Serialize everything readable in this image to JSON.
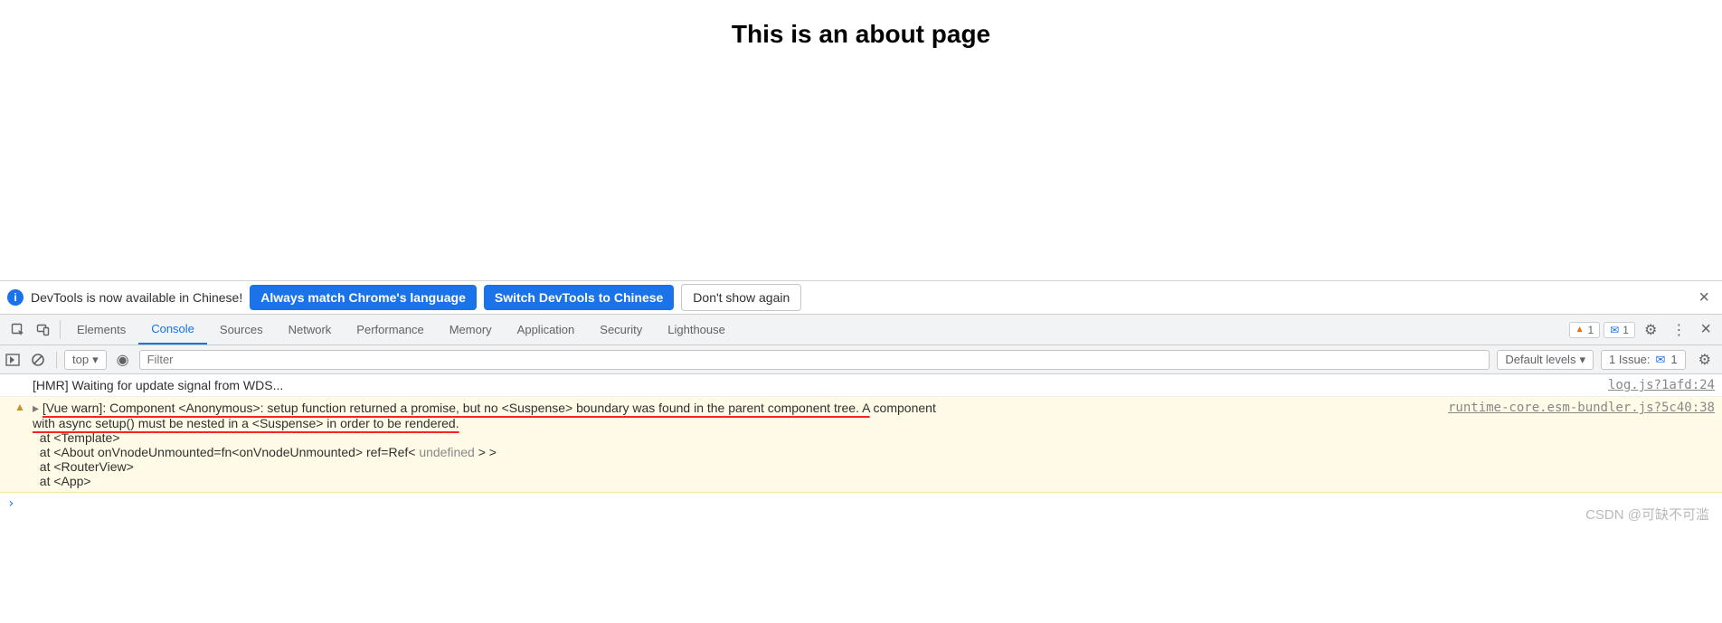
{
  "page": {
    "title": "This is an about page"
  },
  "notice": {
    "text": "DevTools is now available in Chinese!",
    "btn_match": "Always match Chrome's language",
    "btn_switch": "Switch DevTools to Chinese",
    "btn_dont": "Don't show again"
  },
  "tabs": {
    "items": [
      "Elements",
      "Console",
      "Sources",
      "Network",
      "Performance",
      "Memory",
      "Application",
      "Security",
      "Lighthouse"
    ],
    "active_index": 1,
    "warn_count": "1",
    "msg_count": "1"
  },
  "console_tb": {
    "context": "top",
    "filter_placeholder": "Filter",
    "levels": "Default levels",
    "issue_label": "1 Issue:",
    "issue_count": "1"
  },
  "log": {
    "hmr": "[HMR] Waiting for update signal from WDS...",
    "hmr_src": "log.js?1afd:24",
    "warn_red_a": "[Vue warn]: Component <Anonymous>: setup function returned a promise, but no <Suspense> boundary was found in the parent component tree. A",
    "warn_tail_a": " component ",
    "warn_src": "runtime-core.esm-bundler.js?5c40:38",
    "warn_line2": "with async setup() must be nested in a <Suspense> in order to be rendered.",
    "at1": "  at <Template>",
    "at2_a": "  at <About onVnodeUnmounted=fn<onVnodeUnmounted> ref=Ref< ",
    "at2_undef": "undefined",
    "at2_b": " > >",
    "at3": "  at <RouterView>",
    "at4": "  at <App>"
  },
  "watermark": "CSDN @可缺不可滥"
}
